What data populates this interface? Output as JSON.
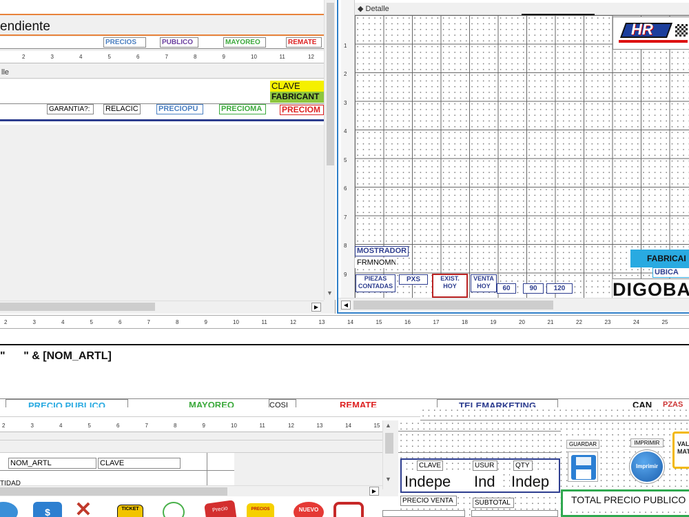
{
  "left_panel": {
    "header_text": "endiente",
    "price_labels": [
      "PRECIOS",
      "PUBLICO",
      "MAYOREO",
      "REMATE"
    ],
    "ruler_numbers": [
      "2",
      "3",
      "4",
      "5",
      "6",
      "7",
      "8",
      "9",
      "10",
      "11",
      "12"
    ],
    "section_label": "lle",
    "clave_label": "CLAVE",
    "fabricante_label": "FABRICANT",
    "fields": [
      "GARANTIA?:",
      "RELACIC",
      "PRECIOPU",
      "PRECIOMA",
      "PRECIOM"
    ]
  },
  "right_panel": {
    "section_label": "Detalle",
    "vertical_ruler": [
      "1",
      "2",
      "3",
      "4",
      "5",
      "6",
      "7",
      "8",
      "9"
    ],
    "mostrador": "MOSTRADOR",
    "frmnom": "FRMNOMN",
    "piezas": "PIEZAS\nCONTADAS",
    "pxs": "PXS",
    "exist": "EXIST.\nHOY",
    "venta": "VENTA\nHOY",
    "cols": [
      "60",
      "90",
      "120"
    ],
    "fabricante": "FABRICAI",
    "ubica": "UBICA",
    "digoba": "DIGOBA",
    "logo_text": "HR"
  },
  "main_ruler": [
    "2",
    "3",
    "4",
    "5",
    "6",
    "7",
    "8",
    "9",
    "10",
    "11",
    "12",
    "13",
    "14",
    "15",
    "16",
    "17",
    "18",
    "19",
    "20",
    "21",
    "22",
    "23",
    "24",
    "25"
  ],
  "expression": "\"      \" & [NOM_ARTL]",
  "lower": {
    "labels": [
      "PRECIO PUBLICO",
      "MAYOREO",
      "COSI",
      "REMATE",
      "TELEMARKETING",
      "CAN",
      "PZAS"
    ],
    "ruler_numbers": [
      "2",
      "3",
      "4",
      "5",
      "6",
      "7",
      "8",
      "9",
      "10",
      "11",
      "12",
      "13",
      "14",
      "15"
    ],
    "nom_artl": "NOM_ARTL",
    "clave": "CLAVE",
    "tidad": "TIDAD"
  },
  "form": {
    "clave": "CLAVE",
    "usur": "USUR",
    "qty": "QTY",
    "indep1": "Indepe",
    "indep2": "Ind",
    "indep3": "Indep",
    "precio_venta": "PRECIO VENTA",
    "subtotal": "SUBTOTAL",
    "guardar": "GUARDAR",
    "imprimir": "IMPRIMIR",
    "imprimir_icon_text": "Imprimir",
    "val": "VAL\nMAT",
    "total": "TOTAL PRECIO PUBLICO"
  },
  "taskbar_icons": [
    {
      "name": "globe-icon",
      "color": "#3a8fd8"
    },
    {
      "name": "money-icon",
      "color": "#2d7fd0"
    },
    {
      "name": "cancel-x-icon",
      "color": "#c0392b"
    },
    {
      "name": "ticket-icon",
      "color": "#f2c400",
      "text": "TICKET"
    },
    {
      "name": "chat-icon",
      "color": "#48b04a"
    },
    {
      "name": "precio-icon",
      "color": "#d32f2f",
      "text": "Precio"
    },
    {
      "name": "precios-icon",
      "color": "#f6d000",
      "text": "PRECIOS"
    },
    {
      "name": "nuevo-icon",
      "color": "#e53935",
      "text": "NUEVO"
    },
    {
      "name": "tools-icon",
      "color": "#c62828"
    }
  ]
}
